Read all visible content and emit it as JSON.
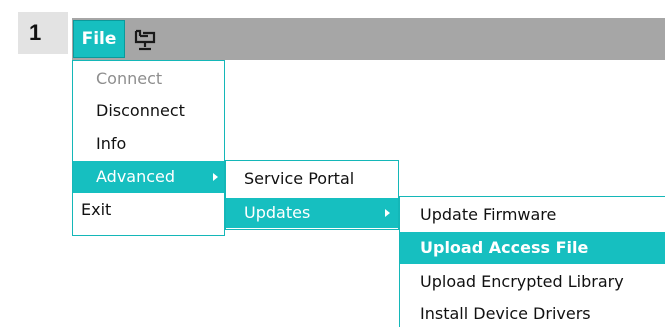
{
  "step": "1",
  "menubar": {
    "file_label": "File",
    "device_icon": "device-monitor-icon"
  },
  "file_menu": {
    "items": [
      {
        "label": "Connect",
        "state": "disabled"
      },
      {
        "label": "Disconnect",
        "state": "normal"
      },
      {
        "label": "Info",
        "state": "normal"
      },
      {
        "label": "Advanced",
        "state": "highlighted",
        "submenu": true
      },
      {
        "label": "Exit",
        "state": "normal"
      }
    ]
  },
  "advanced_menu": {
    "items": [
      {
        "label": "Service Portal",
        "state": "normal"
      },
      {
        "label": "Updates",
        "state": "highlighted",
        "submenu": true
      }
    ]
  },
  "updates_menu": {
    "items": [
      {
        "label": "Update Firmware",
        "state": "normal"
      },
      {
        "label": "Upload Access File",
        "state": "highlighted"
      },
      {
        "label": "Upload Encrypted Library",
        "state": "normal"
      },
      {
        "label": "Install Device Drivers",
        "state": "normal"
      }
    ]
  },
  "colors": {
    "accent": "#16bfc0",
    "titlebar": "#a6a6a6",
    "badge": "#e3e3e3"
  }
}
